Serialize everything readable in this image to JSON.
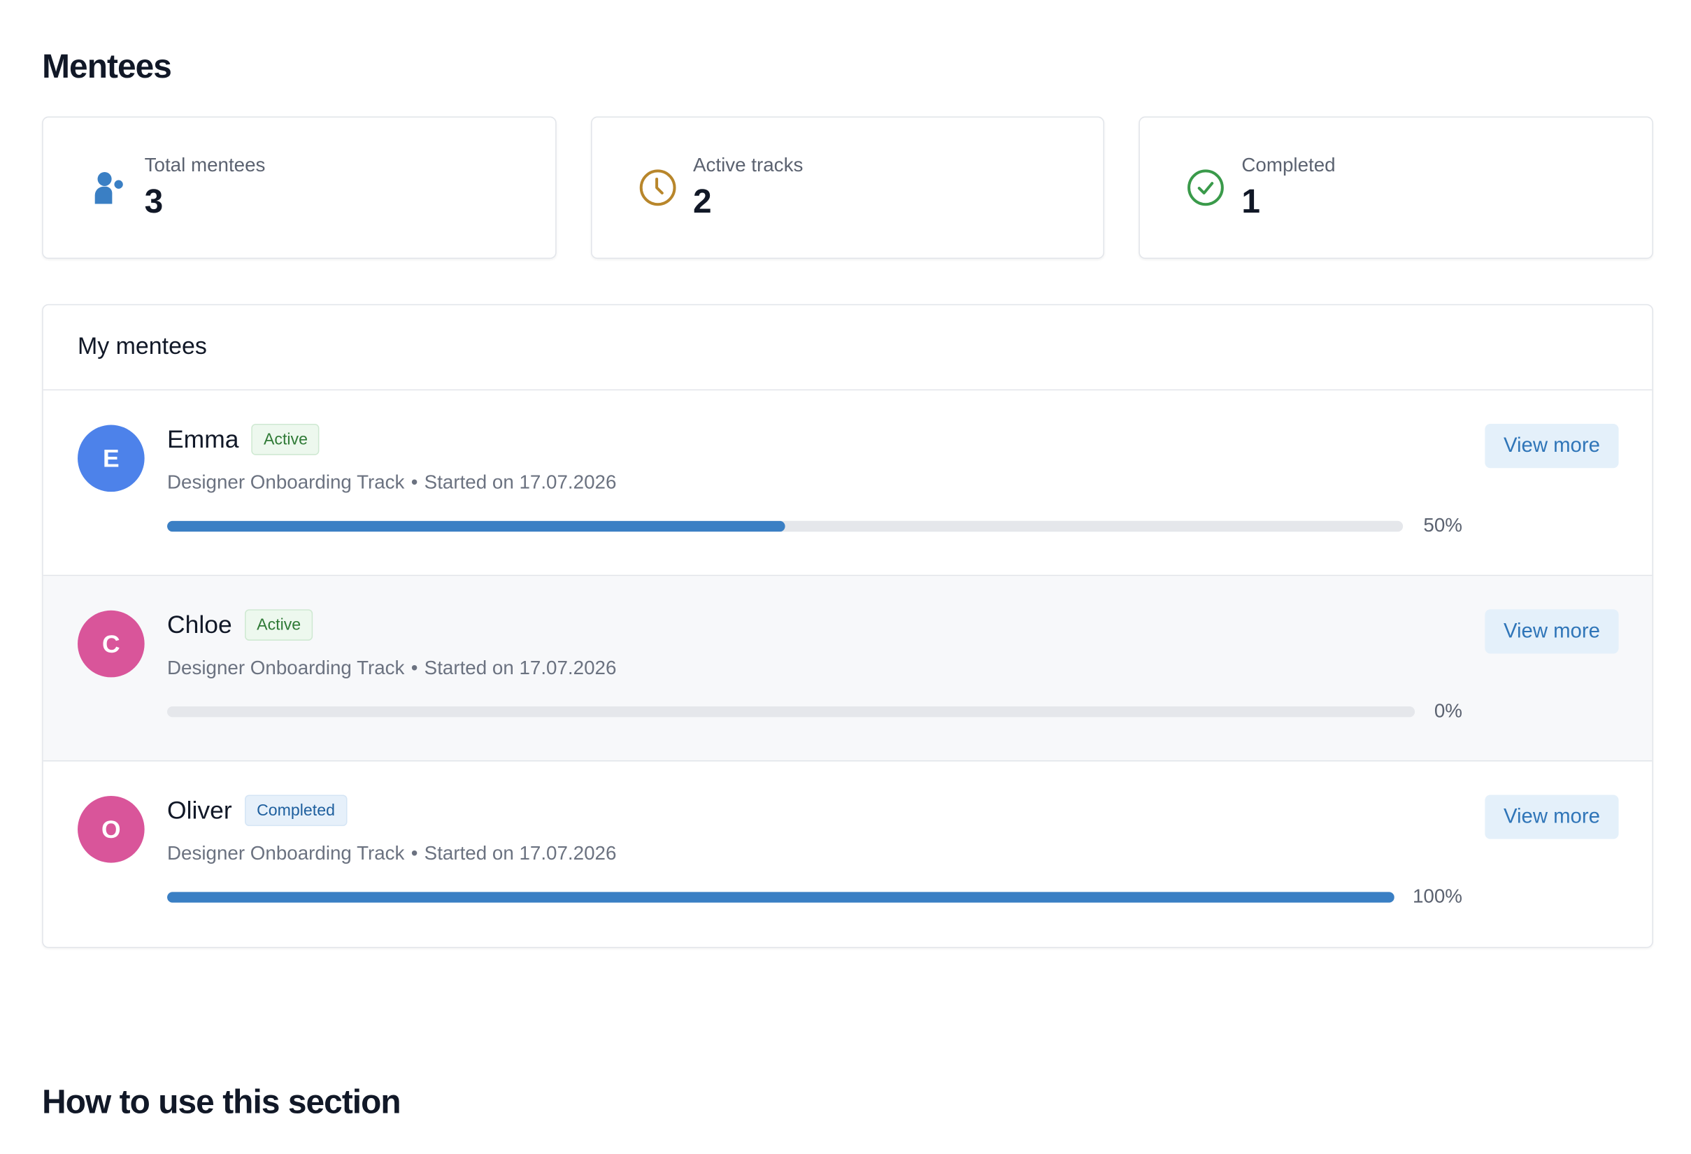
{
  "page": {
    "title": "Mentees"
  },
  "stats": [
    {
      "label": "Total mentees",
      "value": "3",
      "icon": "person-icon",
      "color": "#3a7fc4"
    },
    {
      "label": "Active tracks",
      "value": "2",
      "icon": "clock-icon",
      "color": "#b8862b"
    },
    {
      "label": "Completed",
      "value": "1",
      "icon": "check-circle-icon",
      "color": "#3a9a4a"
    }
  ],
  "list": {
    "title": "My mentees",
    "mentees": [
      {
        "initial": "E",
        "name": "Emma",
        "status": "Active",
        "track": "Designer Onboarding Track",
        "separator": "•",
        "started": "Started on 17.07.2026",
        "progress_label": "50%",
        "progress": 0.5,
        "avatar_color": "#4d82ea",
        "action": "View more"
      },
      {
        "initial": "C",
        "name": "Chloe",
        "status": "Active",
        "track": "Designer Onboarding Track",
        "separator": "•",
        "started": "Started on 17.07.2026",
        "progress_label": "0%",
        "progress": 0,
        "avatar_color": "#d9559a",
        "action": "View more"
      },
      {
        "initial": "O",
        "name": "Oliver",
        "status": "Completed",
        "track": "Designer Onboarding Track",
        "separator": "•",
        "started": "Started on 17.07.2026",
        "progress_label": "100%",
        "progress": 1,
        "avatar_color": "#d9559a",
        "action": "View more"
      }
    ]
  },
  "how_to": {
    "title": "How to use this section"
  },
  "colors": {
    "accent": "#3a7fc4",
    "button_bg": "#e4f0fa",
    "active_badge": "#2f7a36",
    "completed_badge": "#1e5f9e"
  }
}
